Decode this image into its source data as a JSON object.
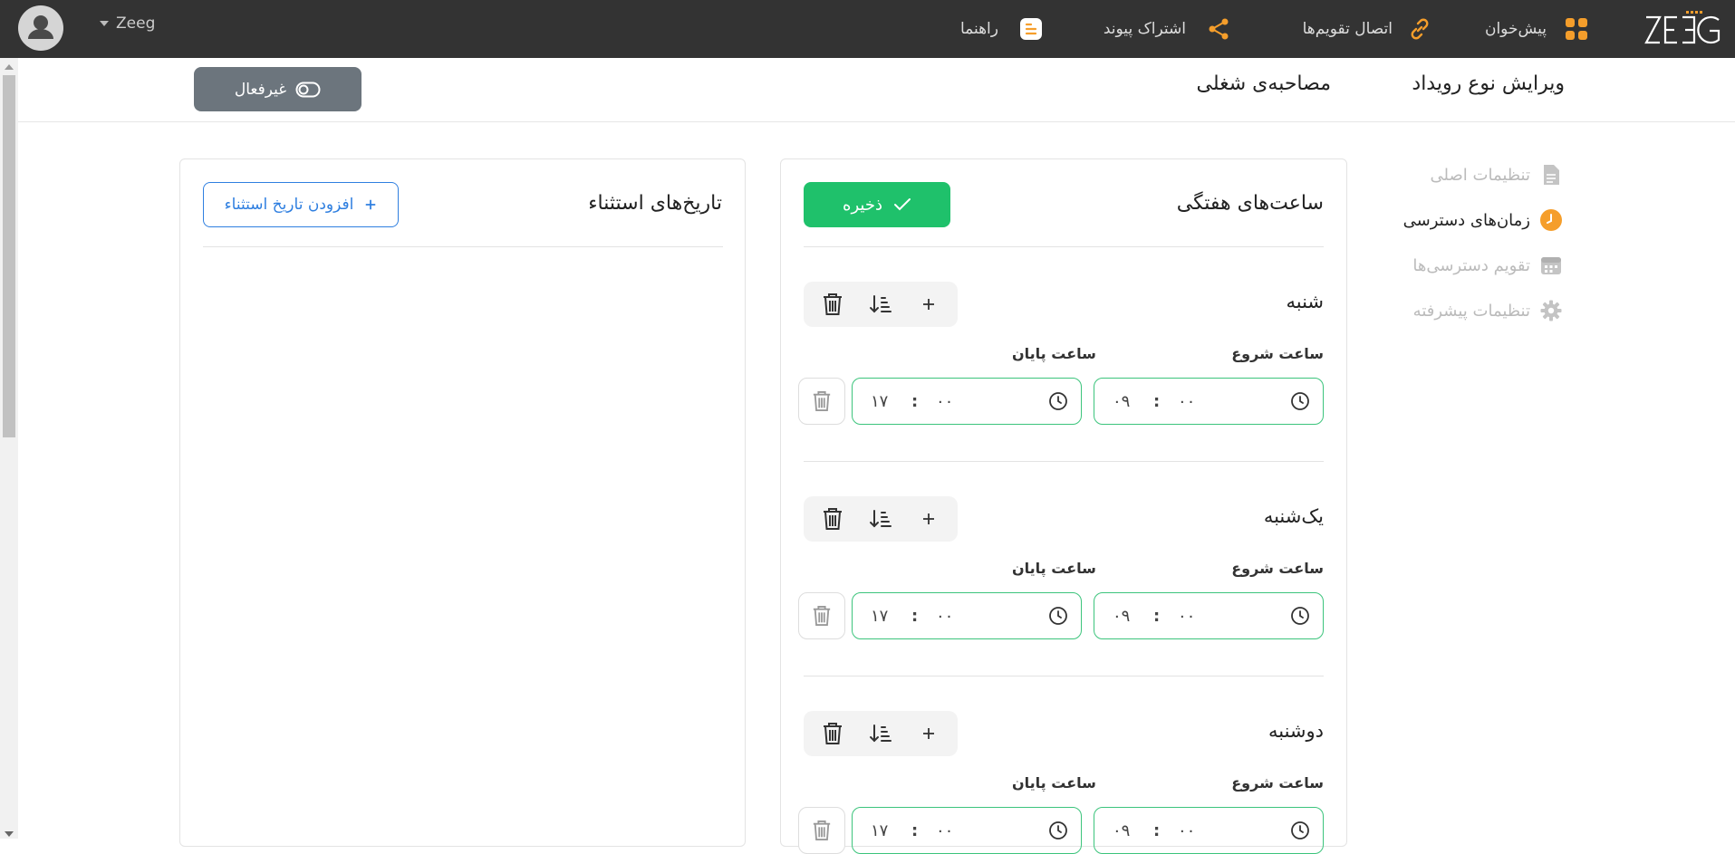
{
  "topbar": {
    "logo_text": "ZEEG",
    "dashboard": "پیش‌خوان",
    "connect_calendars": "اتصال تقویم‌ها",
    "share_link": "اشتراک پیوند",
    "help": "راهنما",
    "username": "Zeeg"
  },
  "colors": {
    "accent_orange": "#f59e2b",
    "green": "#1fc16b",
    "blue": "#2f7fe0",
    "topbar": "#333333"
  },
  "header": {
    "page_title": "ویرایش نوع رویداد",
    "event_name": "مصاحبه‌ی شغلی",
    "inactive_label": "غیرفعال"
  },
  "sidebar": {
    "items": [
      {
        "label": "تنظیمات اصلی",
        "icon": "document-icon"
      },
      {
        "label": "زمان‌های دسترسی",
        "icon": "clock-icon"
      },
      {
        "label": "تقویم دسترسی‌ها",
        "icon": "calendar-icon"
      },
      {
        "label": "تنظیمات پیشرفته",
        "icon": "gear-icon"
      }
    ]
  },
  "weekly": {
    "title": "ساعت‌های هفتگی",
    "save_label": "ذخیره",
    "start_label": "ساعت شروع",
    "end_label": "ساعت پایان",
    "days": [
      {
        "name": "شنبه",
        "start_h": "۰۹",
        "start_m": "۰۰",
        "end_h": "۱۷",
        "end_m": "۰۰"
      },
      {
        "name": "یک‌شنبه",
        "start_h": "۰۹",
        "start_m": "۰۰",
        "end_h": "۱۷",
        "end_m": "۰۰"
      },
      {
        "name": "دوشنبه",
        "start_h": "۰۹",
        "start_m": "۰۰",
        "end_h": "۱۷",
        "end_m": "۰۰"
      }
    ],
    "colon": ":"
  },
  "exceptions": {
    "title": "تاریخ‌های استثناء",
    "add_label": "افزودن تاریخ استثناء"
  }
}
